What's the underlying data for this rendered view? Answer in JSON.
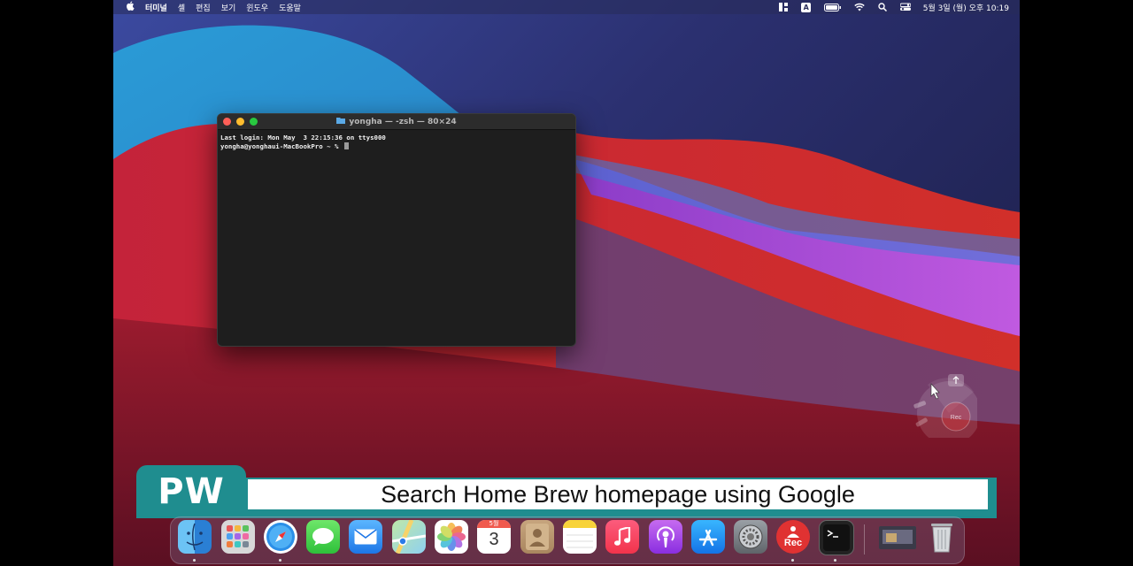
{
  "menubar": {
    "apple_icon": "apple-icon",
    "app_name": "터미널",
    "items": [
      "셸",
      "편집",
      "보기",
      "윈도우",
      "도움말"
    ],
    "right_icons": [
      "control-center-grid-icon",
      "input-source-icon",
      "battery-icon",
      "wifi-icon",
      "spotlight-search-icon",
      "control-center-icon"
    ],
    "input_source_letter": "A",
    "datetime": "5월 3일 (월) 오후 10:19"
  },
  "terminal": {
    "title": "yongha — -zsh — 80×24",
    "lines": [
      "Last login: Mon May  3 22:15:36 on ttys000",
      "yongha@yonghaui-MacBookPro ~ % "
    ]
  },
  "pie_menu": {
    "label": "Rec",
    "icons": [
      "cursor-arrow-icon",
      "upload-icon",
      "pen-icon",
      "highlighter-icon"
    ]
  },
  "banner": {
    "badge": "PW",
    "text": "Search Home Brew homepage using Google",
    "color": "#1f8d8f"
  },
  "dock": {
    "calendar_month": "5월",
    "calendar_day": "3",
    "rec_label": "Rec",
    "apps": [
      {
        "name": "Finder",
        "icon": "finder-icon",
        "running": true
      },
      {
        "name": "Launchpad",
        "icon": "launchpad-icon",
        "running": false
      },
      {
        "name": "Safari",
        "icon": "safari-icon",
        "running": true
      },
      {
        "name": "Messages",
        "icon": "messages-icon",
        "running": false
      },
      {
        "name": "Mail",
        "icon": "mail-icon",
        "running": false
      },
      {
        "name": "Maps",
        "icon": "maps-icon",
        "running": false
      },
      {
        "name": "Photos",
        "icon": "photos-icon",
        "running": false
      },
      {
        "name": "Calendar",
        "icon": "calendar-icon",
        "running": false
      },
      {
        "name": "Contacts",
        "icon": "contacts-icon",
        "running": false
      },
      {
        "name": "Notes",
        "icon": "notes-icon",
        "running": false
      },
      {
        "name": "Music",
        "icon": "music-icon",
        "running": false
      },
      {
        "name": "Podcasts",
        "icon": "podcasts-icon",
        "running": false
      },
      {
        "name": "App Store",
        "icon": "app-store-icon",
        "running": false
      },
      {
        "name": "System Preferences",
        "icon": "system-preferences-icon",
        "running": false
      },
      {
        "name": "Screen Recorder",
        "icon": "rec-icon",
        "running": true
      },
      {
        "name": "Terminal",
        "icon": "terminal-icon",
        "running": true
      },
      {
        "name": "Desktop Thumbnail",
        "icon": "window-thumbnail-icon",
        "running": false
      },
      {
        "name": "Trash",
        "icon": "trash-icon",
        "running": false
      }
    ]
  }
}
